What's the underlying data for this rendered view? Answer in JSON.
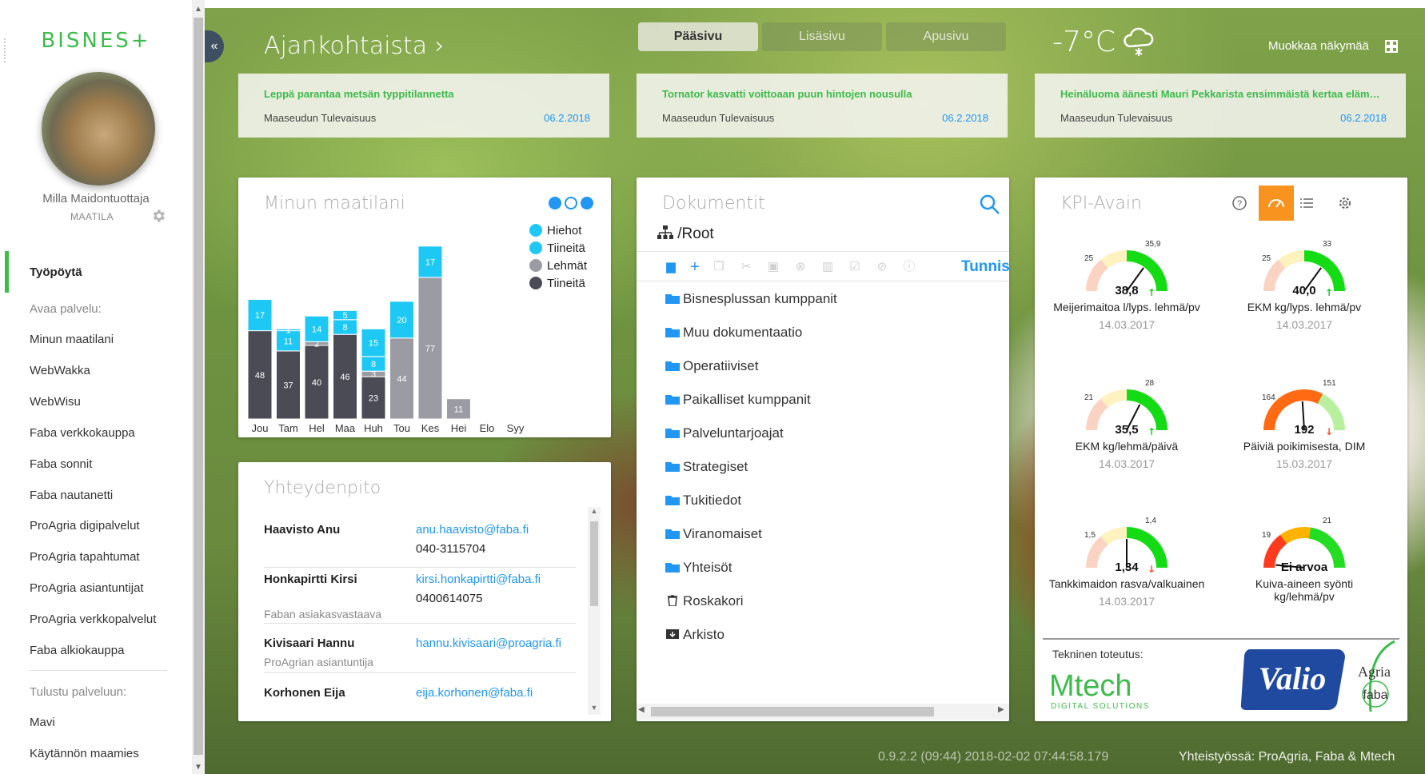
{
  "sidebar": {
    "brand": "BISNES+",
    "user_name": "Milla Maidontuottaja",
    "user_role": "MAATILA",
    "active": "Työpöytä",
    "section_open": "Avaa palvelu:",
    "items_open": [
      "Minun maatilani",
      "WebWakka",
      "WebWisu",
      "Faba verkkokauppa",
      "Faba sonnit",
      "Faba nautanetti",
      "ProAgria digipalvelut",
      "ProAgria tapahtumat",
      "ProAgria asiantuntijat",
      "ProAgria verkkopalvelut",
      "Faba alkiokauppa"
    ],
    "section_print": "Tulustu palveluun:",
    "items_print": [
      "Mavi",
      "Käytännön maamies"
    ]
  },
  "header": {
    "title": "Ajankohtaista",
    "tabs": [
      "Pääsivu",
      "Lisäsivu",
      "Apusivu"
    ],
    "active_tab": "Pääsivu",
    "temperature": "-7°C",
    "edit_view": "Muokkaa näkymää"
  },
  "news": [
    {
      "headline": "Leppä parantaa metsän typpitilannetta",
      "source": "Maaseudun Tulevaisuus",
      "date": "06.2.2018"
    },
    {
      "headline": "Tornator kasvatti voittoaan puun hintojen nousulla",
      "source": "Maaseudun Tulevaisuus",
      "date": "06.2.2018"
    },
    {
      "headline": "Heinäluoma äänesti Mauri Pekkarista ensimmäistä kertaa elämässään",
      "source": "Maaseudun Tulevaisuus",
      "date": "06.2.2018"
    }
  ],
  "farm": {
    "title": "Minun maatilani",
    "colors": {
      "hiehot": "#1ec8f5",
      "tiineita": "#9b9ba3",
      "lehmat": "#4b4b55",
      "tiineita_light": "#1ec8f5"
    }
  },
  "chart_data": {
    "type": "bar",
    "stacked": true,
    "categories": [
      "Jou",
      "Tam",
      "Hel",
      "Maa",
      "Huh",
      "Tou",
      "Kes",
      "Hei",
      "Elo",
      "Syy"
    ],
    "series": [
      {
        "name": "Lehmät",
        "values": [
          48,
          37,
          40,
          46,
          23,
          0,
          0,
          0,
          0,
          0
        ],
        "color": "#4b4b55"
      },
      {
        "name": "Tiineitä",
        "values": [
          0,
          0,
          2,
          0,
          3,
          44,
          77,
          11,
          0,
          0
        ],
        "color": "#9b9ba3"
      },
      {
        "name": "Tiineitä",
        "values": [
          0,
          11,
          0,
          8,
          8,
          0,
          0,
          0,
          0,
          0
        ],
        "color": "#1ec8f5"
      },
      {
        "name": "Hiehot",
        "values": [
          17,
          1,
          14,
          5,
          15,
          20,
          17,
          0,
          0,
          0
        ],
        "color": "#1ec8f5"
      }
    ],
    "legend": [
      "Hiehot",
      "Tiineitä",
      "Lehmät",
      "Tiineitä"
    ],
    "legend_colors": [
      "#1ec8f5",
      "#1ec8f5",
      "#9b9ba3",
      "#4b4b55"
    ],
    "ylim": [
      0,
      100
    ],
    "legend_position": "top-right"
  },
  "contacts": {
    "title": "Yhteydenpito",
    "rows": [
      {
        "name": "Haavisto Anu",
        "email": "anu.haavisto@faba.fi",
        "phone": "040-3115704",
        "role": ""
      },
      {
        "name": "Honkapirtti Kirsi",
        "email": "kirsi.honkapirtti@faba.fi",
        "phone": "0400614075",
        "role": "Faban asiakasvastaava"
      },
      {
        "name": "Kivisaari Hannu",
        "email": "hannu.kivisaari@proagria.fi",
        "phone": "",
        "role": "ProAgrian asiantuntija"
      },
      {
        "name": "Korhonen Eija",
        "email": "eija.korhonen@faba.fi",
        "phone": "",
        "role": ""
      }
    ]
  },
  "docs": {
    "title": "Dokumentit",
    "root": "/Root",
    "toolbar_label": "Tunnis",
    "folders": [
      "Bisnesplussan kumppanit",
      "Muu dokumentaatio",
      "Operatiiviset",
      "Paikalliset kumppanit",
      "Palveluntarjoajat",
      "Strategiset",
      "Tukitiedot",
      "Viranomaiset",
      "Yhteisöt"
    ],
    "trash": "Roskakori",
    "archive": "Arkisto"
  },
  "kpi": {
    "title": "KPI-Avain",
    "gauges": [
      {
        "label": "Meijerimaitoa l/lyps. lehmä/pv",
        "date": "14.03.2017",
        "value": "38,8",
        "trend": "up",
        "t1": "25",
        "t2": "35,9",
        "tone": "green"
      },
      {
        "label": "EKM kg/lyps. lehmä/pv",
        "date": "14.03.2017",
        "value": "40,0",
        "trend": "up",
        "t1": "25",
        "t2": "33",
        "tone": "green"
      },
      {
        "label": "EKM kg/lehmä/päivä",
        "date": "14.03.2017",
        "value": "35,5",
        "trend": "up",
        "t1": "21",
        "t2": "28",
        "tone": "green"
      },
      {
        "label": "Päiviä poikimisesta, DIM",
        "date": "15.03.2017",
        "value": "192",
        "trend": "down",
        "t1": "164",
        "t2": "151",
        "tone": "red"
      },
      {
        "label": "Tankkimaidon rasva/valkuainen",
        "date": "14.03.2017",
        "value": "1,34",
        "trend": "down",
        "t1": "1,5",
        "t2": "1,4",
        "tone": "green"
      },
      {
        "label": "Kuiva-aineen syönti kg/lehmä/pv",
        "date": "",
        "value": "Ei arvoa",
        "trend": "none",
        "t1": "19",
        "t2": "21",
        "tone": "mixed"
      }
    ],
    "tech_label": "Tekninen toteutus:",
    "brand_mtech": "Mtech",
    "brand_mtech_sub": "DIGITAL SOLUTIONS",
    "brand_valio": "Valio",
    "brand_proagria": "Agria",
    "brand_faba": "faba",
    "accent": "#f7931e"
  },
  "footer": {
    "version": "0.9.2.2 (09:44) 2018-02-02 07:44:58.179",
    "partners": "Yhteistyössä: ProAgria, Faba & Mtech"
  }
}
